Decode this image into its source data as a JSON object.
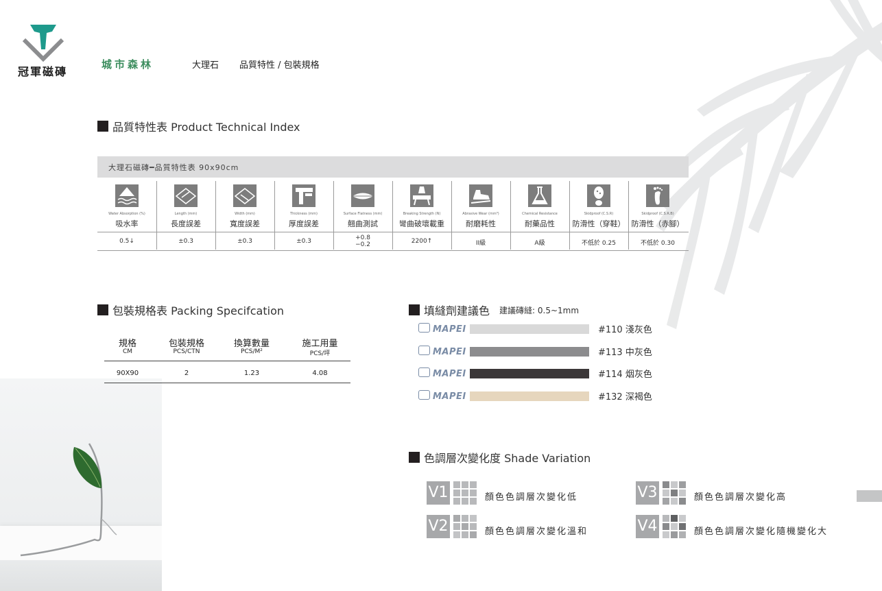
{
  "brand": {
    "name": "冠軍磁磚"
  },
  "header": {
    "series": "城市森林",
    "category": "大理石",
    "subtitle": "品質特性 / 包裝規格"
  },
  "tech": {
    "section_title": "品質特性表 Product Technical Index",
    "bar_title": "大理石磁磚━品質特性表 90x90cm",
    "columns": [
      {
        "en": "Water Absorption (%)",
        "zh": "吸水率",
        "value": "0.5↓",
        "icon": "water-drop-icon"
      },
      {
        "en": "Length (mm)",
        "zh": "長度誤差",
        "value": "±0.3",
        "icon": "length-icon"
      },
      {
        "en": "Width (mm)",
        "zh": "寬度誤差",
        "value": "±0.3",
        "icon": "width-icon"
      },
      {
        "en": "Thickness (mm)",
        "zh": "厚度誤差",
        "value": "±0.3",
        "icon": "caliper-icon"
      },
      {
        "en": "Surface Flatness (mm)",
        "zh": "翹曲測試",
        "value_top": "+0.8",
        "value_bottom": "−0.2",
        "icon": "flatness-icon"
      },
      {
        "en": "Breaking Strength (N)",
        "zh": "彎曲破壞載重",
        "value": "2200↑",
        "icon": "weight-icon"
      },
      {
        "en": "Abrasive Wear (mm³)",
        "zh": "耐磨耗性",
        "value": "II級",
        "icon": "shoe-icon"
      },
      {
        "en": "Chemical Resistance",
        "zh": "耐藥品性",
        "value": "A級",
        "icon": "flask-icon"
      },
      {
        "en": "Skidproof (C.S.R)",
        "zh": "防滑性（穿鞋）",
        "value": "不低於 0.25",
        "icon": "shoe-print-icon"
      },
      {
        "en": "Skidproof (C.S.R.B)",
        "zh": "防滑性（赤腳）",
        "value": "不低於 0.30",
        "icon": "footprint-icon"
      }
    ]
  },
  "packing": {
    "section_title": "包裝規格表 Packing Specifcation",
    "headers": [
      {
        "label": "規格",
        "sub": "CM"
      },
      {
        "label": "包裝規格",
        "sub": "PCS/CTN"
      },
      {
        "label": "換算數量",
        "sub": "PCS/M²"
      },
      {
        "label": "施工用量",
        "sub": "PCS/坪"
      }
    ],
    "rows": [
      [
        "90X90",
        "2",
        "1.23",
        "4.08"
      ]
    ]
  },
  "grout": {
    "section_title": "填縫劑建議色",
    "note": "建議磚縫: 0.5~1mm",
    "brand": "MAPEI",
    "items": [
      {
        "name": "#110 淺灰色",
        "color": "#d9d9d9"
      },
      {
        "name": "#113 中灰色",
        "color": "#8c8c8e"
      },
      {
        "name": "#114 烟灰色",
        "color": "#3b3738"
      },
      {
        "name": "#132 深褐色",
        "color": "#e6d6bd"
      }
    ]
  },
  "shade": {
    "section_title": "色調層次變化度 Shade Variation",
    "items": [
      {
        "code": "V1",
        "text": "顏色色調層次變化低"
      },
      {
        "code": "V2",
        "text": "顏色色調層次變化溫和"
      },
      {
        "code": "V3",
        "text": "顏色色調層次變化高"
      },
      {
        "code": "V4",
        "text": "顏色色調層次變化隨機變化大"
      }
    ]
  }
}
